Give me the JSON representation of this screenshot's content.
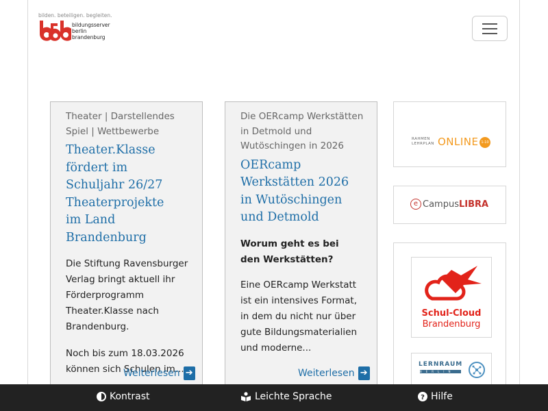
{
  "logo": {
    "tagline": "bilden. beteiligen. begleiten.",
    "line1": "bildungsserver",
    "line2": "berlin",
    "line3": "brandenburg"
  },
  "header": {
    "menu_icon": "hamburger-icon"
  },
  "cards": [
    {
      "category": "Theater | Darstellendes Spiel | Wettbewerbe",
      "title": "Theater.Klasse fördert im Schuljahr 26/27 Theaterprojekte im Land Brandenburg",
      "text1": "Die Stiftung Ravensburger Verlag bringt aktuell ihr Förderprogramm Theater.Klasse nach Brandenburg.",
      "text2": "Noch bis zum 18.03.2026 können sich Schulen im...",
      "more": "Weiterlesen"
    },
    {
      "category": "Die OERcamp Werkstätten in Detmold und Wutöschingen in 2026",
      "title": "OERcamp Werkstätten 2026 in Wutöschingen und Detmold",
      "question": "Worum geht es bei den Werkstätten?",
      "text1": "Eine OERcamp Werkstatt ist ein intensives Format, in dem du nicht nur über gute Bildungsmaterialien und moderne...",
      "more": "Weiterlesen"
    }
  ],
  "sidebar": {
    "rahmenlehrplan": {
      "small1": "RAHMEN",
      "small2": "LEHRPLAN",
      "big": "ONLINE",
      "badge": "1-10"
    },
    "ecampus": {
      "prefix": "Campus",
      "suffix": "LIBRA"
    },
    "schulcloud": {
      "line1": "Schul-Cloud",
      "line2": "Brandenburg"
    },
    "lernraum": {
      "line1": "LERNRAUM",
      "line2": "BERLIN"
    }
  },
  "colors": {
    "link": "#1e6ea7",
    "logo_red": "#d9322a",
    "bar": "#222222",
    "lro_orange": "#f39a1f"
  },
  "bottombar": {
    "contrast": "Kontrast",
    "easy": "Leichte Sprache",
    "help": "Hilfe"
  }
}
